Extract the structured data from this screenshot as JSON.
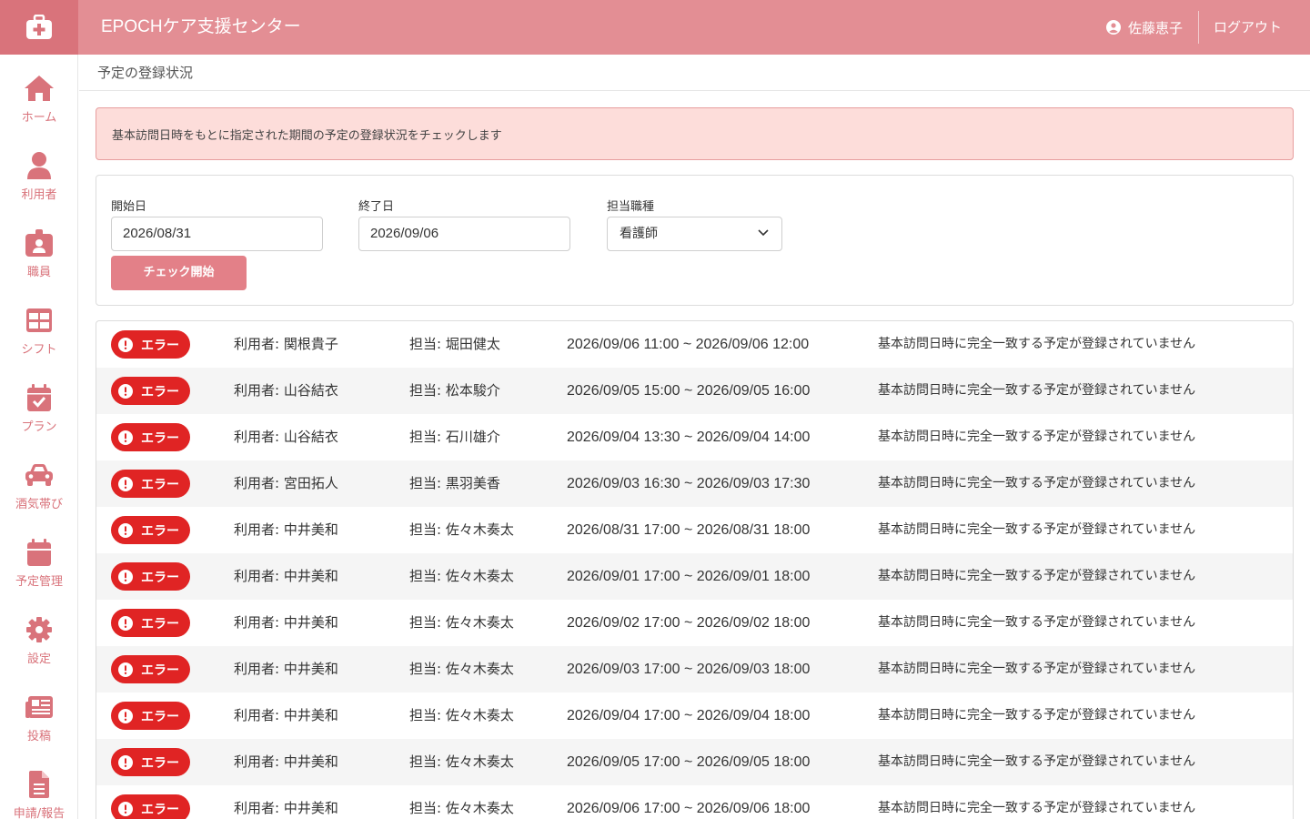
{
  "header": {
    "app_title": "EPOCHケア支援センター",
    "user_name": "佐藤恵子",
    "logout_label": "ログアウト",
    "colors": {
      "header_bg": "#e38e94",
      "logo_bg": "#d9737b"
    }
  },
  "sidebar": {
    "items": [
      {
        "label": "ホーム",
        "icon": "home-icon"
      },
      {
        "label": "利用者",
        "icon": "user-icon"
      },
      {
        "label": "職員",
        "icon": "staff-badge-icon"
      },
      {
        "label": "シフト",
        "icon": "table-icon"
      },
      {
        "label": "プラン",
        "icon": "calendar-check-icon"
      },
      {
        "label": "酒気帯び",
        "icon": "car-icon"
      },
      {
        "label": "予定管理",
        "icon": "calendar-icon"
      },
      {
        "label": "設定",
        "icon": "gear-icon"
      },
      {
        "label": "投稿",
        "icon": "newspaper-icon"
      },
      {
        "label": "申請/報告",
        "icon": "document-icon"
      }
    ]
  },
  "breadcrumb": {
    "title": "予定の登録状況"
  },
  "alert": {
    "message": "基本訪問日時をもとに指定された期間の予定の登録状況をチェックします"
  },
  "filter": {
    "start_label": "開始日",
    "start_value": "2026/08/31",
    "end_label": "終了日",
    "end_value": "2026/09/06",
    "role_label": "担当職種",
    "role_value": "看護師",
    "check_button": "チェック開始"
  },
  "results": {
    "badge_label": "エラー",
    "rows": [
      {
        "user": "利用者: 関根貴子",
        "staff": "担当: 堀田健太",
        "period": "2026/09/06 11:00 ~ 2026/09/06 12:00",
        "message": "基本訪問日時に完全一致する予定が登録されていません"
      },
      {
        "user": "利用者: 山谷結衣",
        "staff": "担当: 松本駿介",
        "period": "2026/09/05 15:00 ~ 2026/09/05 16:00",
        "message": "基本訪問日時に完全一致する予定が登録されていません"
      },
      {
        "user": "利用者: 山谷結衣",
        "staff": "担当: 石川雄介",
        "period": "2026/09/04 13:30 ~ 2026/09/04 14:00",
        "message": "基本訪問日時に完全一致する予定が登録されていません"
      },
      {
        "user": "利用者: 宮田拓人",
        "staff": "担当: 黒羽美香",
        "period": "2026/09/03 16:30 ~ 2026/09/03 17:30",
        "message": "基本訪問日時に完全一致する予定が登録されていません"
      },
      {
        "user": "利用者: 中井美和",
        "staff": "担当: 佐々木奏太",
        "period": "2026/08/31 17:00 ~ 2026/08/31 18:00",
        "message": "基本訪問日時に完全一致する予定が登録されていません"
      },
      {
        "user": "利用者: 中井美和",
        "staff": "担当: 佐々木奏太",
        "period": "2026/09/01 17:00 ~ 2026/09/01 18:00",
        "message": "基本訪問日時に完全一致する予定が登録されていません"
      },
      {
        "user": "利用者: 中井美和",
        "staff": "担当: 佐々木奏太",
        "period": "2026/09/02 17:00 ~ 2026/09/02 18:00",
        "message": "基本訪問日時に完全一致する予定が登録されていません"
      },
      {
        "user": "利用者: 中井美和",
        "staff": "担当: 佐々木奏太",
        "period": "2026/09/03 17:00 ~ 2026/09/03 18:00",
        "message": "基本訪問日時に完全一致する予定が登録されていません"
      },
      {
        "user": "利用者: 中井美和",
        "staff": "担当: 佐々木奏太",
        "period": "2026/09/04 17:00 ~ 2026/09/04 18:00",
        "message": "基本訪問日時に完全一致する予定が登録されていません"
      },
      {
        "user": "利用者: 中井美和",
        "staff": "担当: 佐々木奏太",
        "period": "2026/09/05 17:00 ~ 2026/09/05 18:00",
        "message": "基本訪問日時に完全一致する予定が登録されていません"
      },
      {
        "user": "利用者: 中井美和",
        "staff": "担当: 佐々木奏太",
        "period": "2026/09/06 17:00 ~ 2026/09/06 18:00",
        "message": "基本訪問日時に完全一致する予定が登録されていません"
      }
    ]
  }
}
